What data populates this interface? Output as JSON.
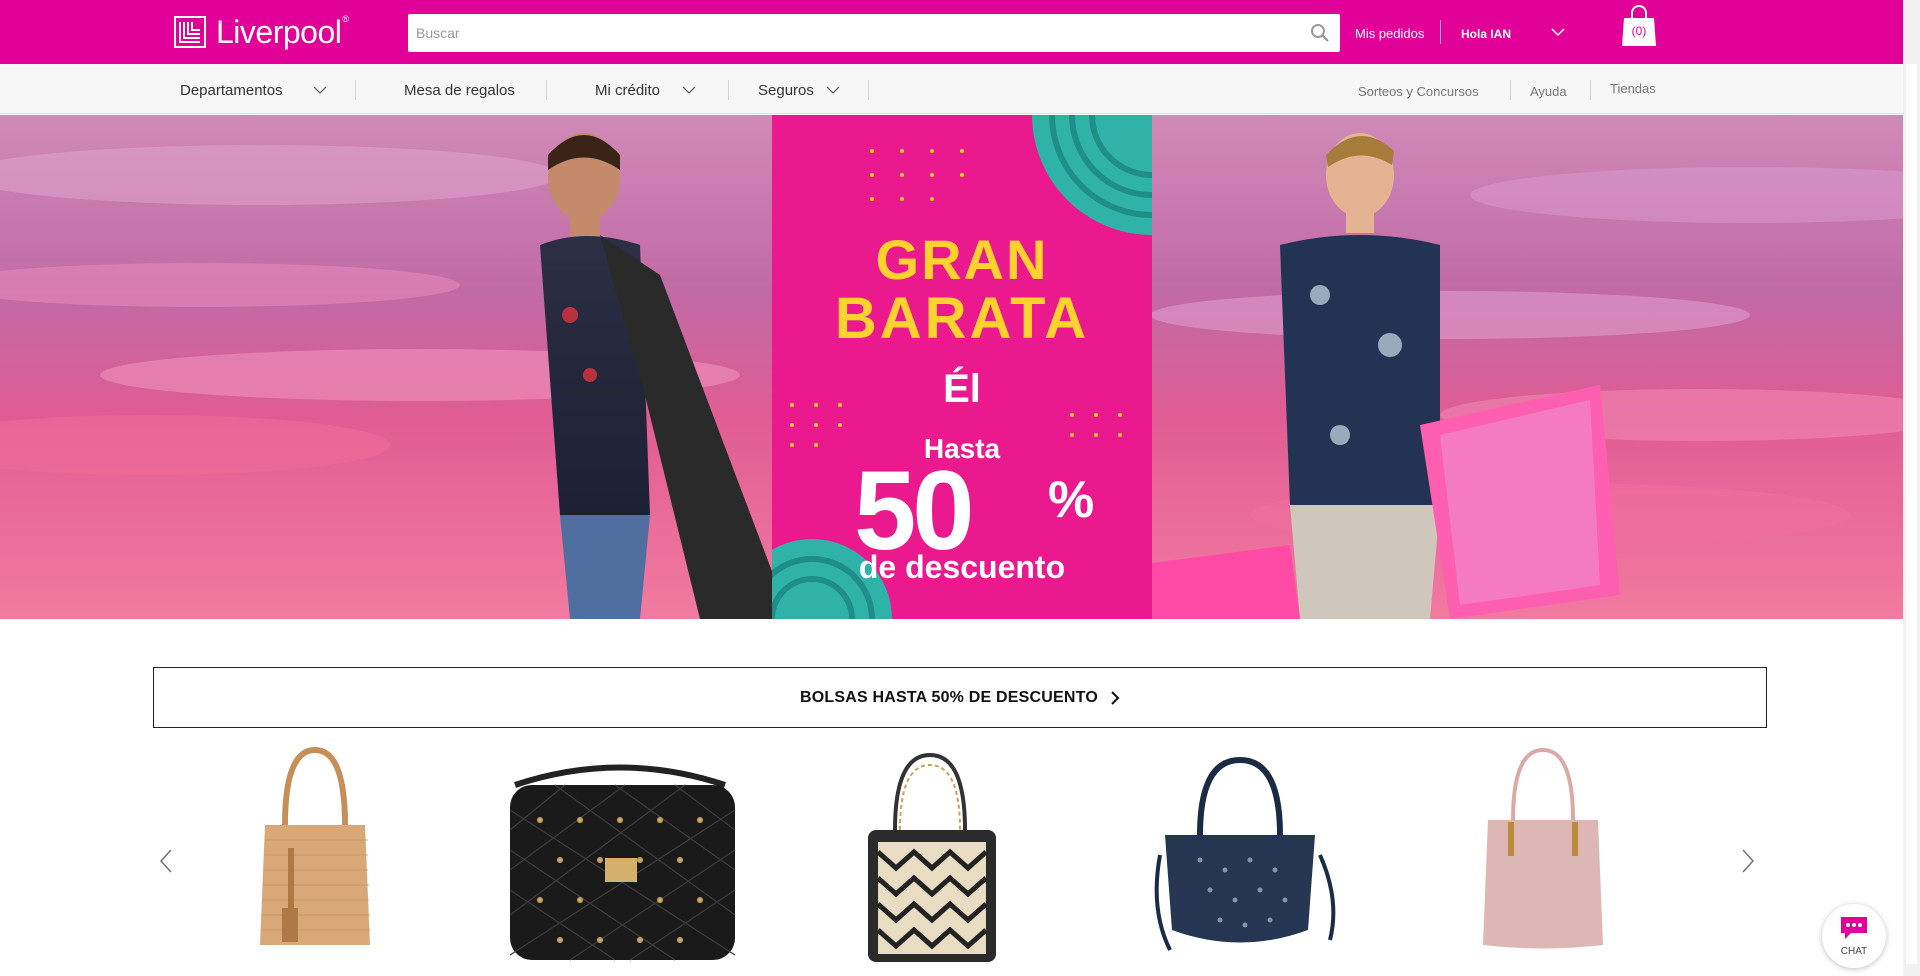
{
  "header": {
    "brand": "Liverpool",
    "brand_mark": "®",
    "search_placeholder": "Buscar",
    "mis_pedidos": "Mis pedidos",
    "greeting": "Hola IAN",
    "cart_count": "(0)"
  },
  "nav": {
    "departamentos": "Departamentos",
    "mesa": "Mesa de regalos",
    "credito": "Mi crédito",
    "seguros": "Seguros",
    "sorteos": "Sorteos y Concursos",
    "ayuda": "Ayuda",
    "tiendas": "Tiendas"
  },
  "hero": {
    "line1": "GRAN",
    "line2": "BARATA",
    "line3": "Él",
    "hasta": "Hasta",
    "percent_value": "50",
    "percent_sign": "%",
    "descuento": "de descuento"
  },
  "promo": {
    "label": "BOLSAS HASTA 50% DE DESCUENTO"
  },
  "products": [
    {
      "icon": "tan-tote-bag-icon",
      "color": "#d9a877"
    },
    {
      "icon": "black-quilted-bag-icon",
      "color": "#1a1a1a"
    },
    {
      "icon": "chevron-pattern-bag-icon",
      "color": "#2b2b2b"
    },
    {
      "icon": "navy-studded-bag-icon",
      "color": "#243652"
    },
    {
      "icon": "pink-tote-bag-icon",
      "color": "#ddb7b3"
    }
  ],
  "chat": {
    "label": "CHAT"
  },
  "colors": {
    "brand": "#e10098",
    "hero_panel": "#ea1a8e",
    "hero_yellow": "#ffd22e"
  }
}
